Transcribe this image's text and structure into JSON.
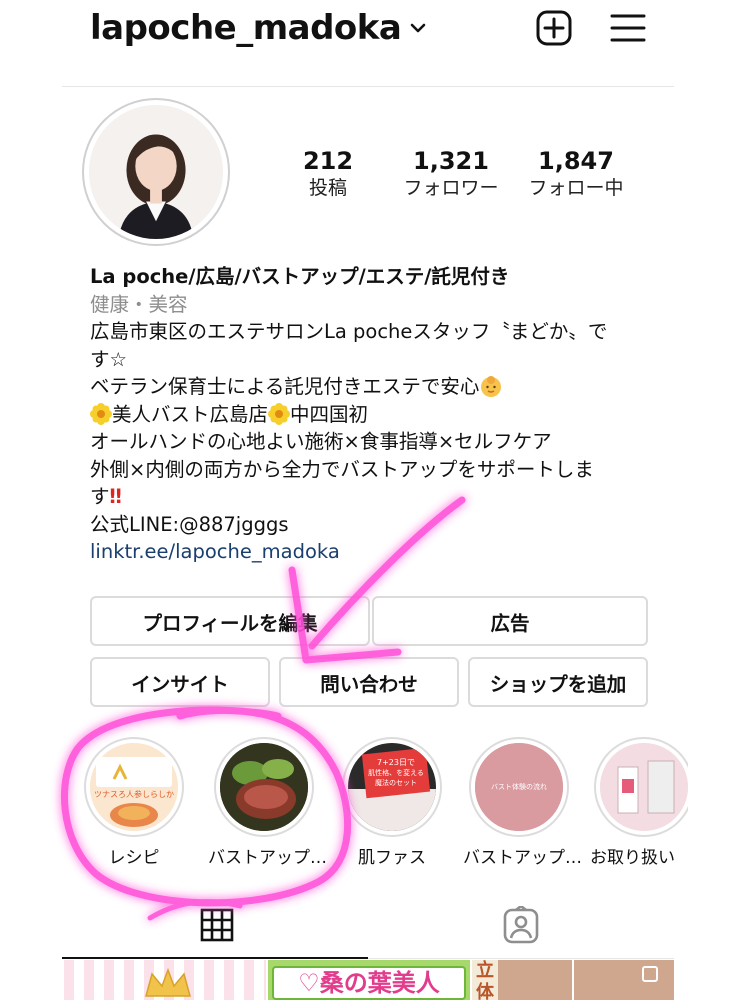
{
  "header": {
    "username": "lapoche_madoka"
  },
  "stats": [
    {
      "value": "212",
      "label": "投稿"
    },
    {
      "value": "1,321",
      "label": "フォロワー"
    },
    {
      "value": "1,847",
      "label": "フォロー中"
    }
  ],
  "bio": {
    "name": "La poche/広島/バストアップ/エステ/託児付き",
    "category": "健康・美容",
    "line1": "広島市東区のエステサロンLa pocheスタッフ〝まどか〟で",
    "line2": "す☆",
    "line3": "ベテラン保育士による託児付きエステで安心",
    "line4_a": "美人バスト広島店",
    "line4_b": "中四国初",
    "line5": "オールハンドの心地よい施術×食事指導×セルフケア",
    "line6": "外側×内側の両方から全力でバストアップをサポートしま",
    "line7": "す",
    "line7_mark": "‼",
    "line8": "公式LINE:@887jgggs",
    "link": "linktr.ee/lapoche_madoka"
  },
  "buttons": {
    "edit_profile": "プロフィールを編集",
    "ads": "広告",
    "insights": "インサイト",
    "contact": "問い合わせ",
    "add_shop": "ショップを追加"
  },
  "highlights": [
    {
      "label": "レシピ"
    },
    {
      "label": "バストアップ…"
    },
    {
      "label": "肌ファス"
    },
    {
      "label": "バストアップ…"
    },
    {
      "label": "お取り扱い"
    }
  ],
  "highlight_texts": {
    "h1_title": "ツナスろ人参しらしか",
    "h3_line1": "7+23日で",
    "h3_line2": "肌性格、を変える",
    "h3_line3": "魔法のセット",
    "h4_text": "バスト体験の流れ"
  },
  "grid_preview": {
    "thumb2_text": "♡桑の葉美人",
    "thumb3_text": "立体"
  },
  "colors": {
    "link": "#1a3e6e",
    "annotation": "#ff4fd8",
    "border": "#dbdbdb"
  },
  "icons": [
    "chevron-down-icon",
    "plus-square-icon",
    "menu-icon",
    "grid-icon",
    "tagged-icon",
    "flower-emoji",
    "baby-emoji"
  ]
}
